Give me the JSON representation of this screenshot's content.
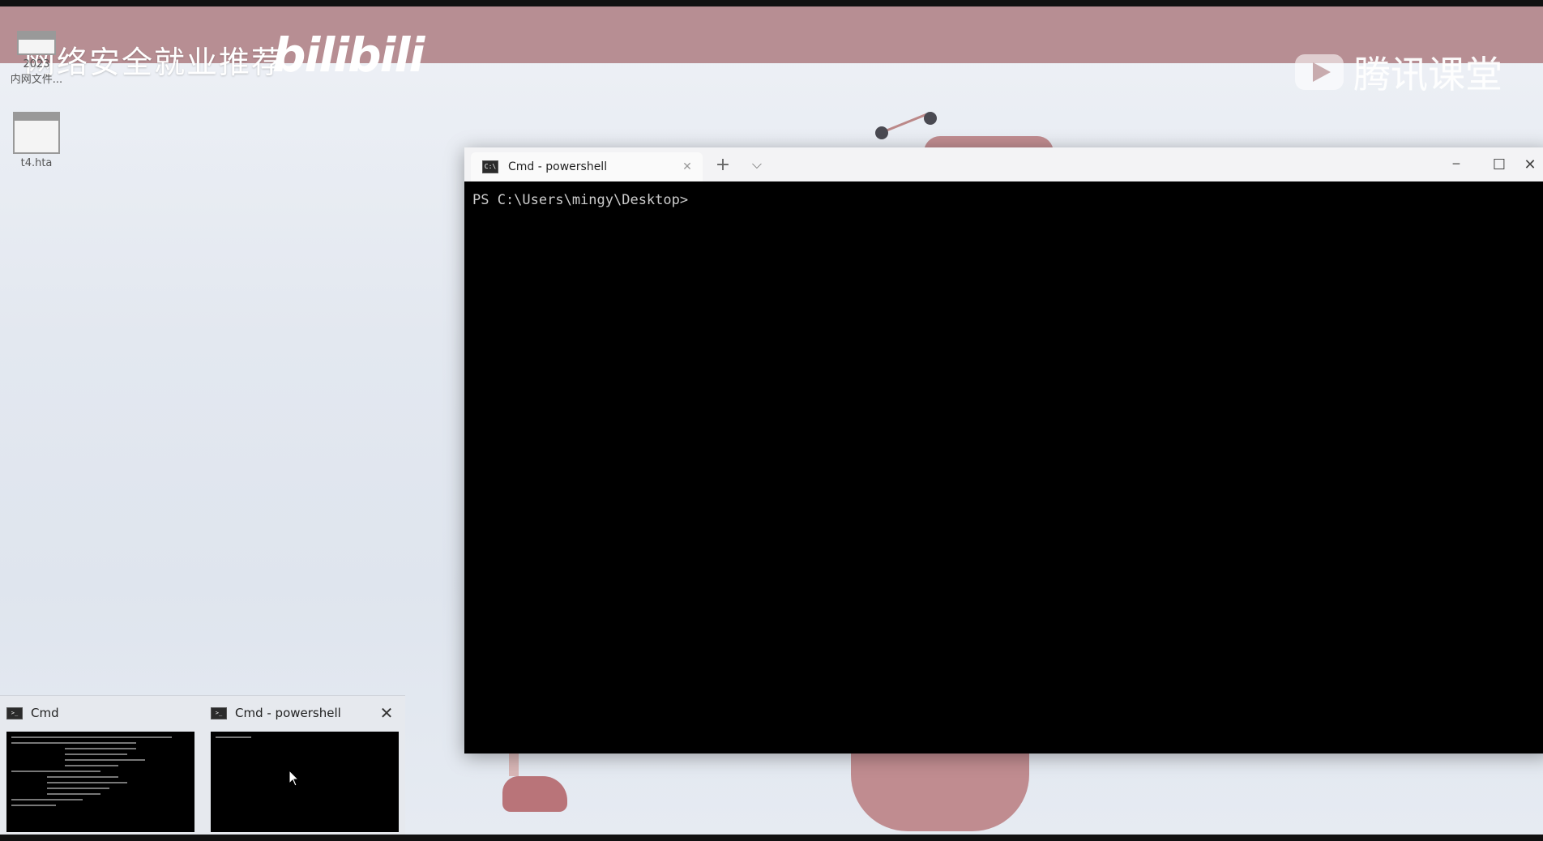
{
  "watermarks": {
    "left_text": "网络安全就业推荐",
    "left_brand": "bilibili",
    "right_text": "腾讯课堂"
  },
  "desktop_icons": [
    {
      "label_line1": "2023",
      "label_line2": "内网文件..."
    },
    {
      "label_line1": "t4.hta",
      "label_line2": ""
    }
  ],
  "terminal": {
    "tab_title": "Cmd - powershell",
    "tab_icon_text": "C:\\",
    "new_tab_glyph": "+",
    "dropdown_glyph": "⌵",
    "minimize_glyph": "─",
    "maximize_glyph": "☐",
    "close_glyph": "✕",
    "tab_close_glyph": "✕",
    "prompt": "PS C:\\Users\\mingy\\Desktop>"
  },
  "taskbar_preview": {
    "items": [
      {
        "title": "Cmd",
        "icon_text": ">_",
        "close_glyph": ""
      },
      {
        "title": "Cmd - powershell",
        "icon_text": ">_",
        "close_glyph": "✕"
      }
    ]
  }
}
